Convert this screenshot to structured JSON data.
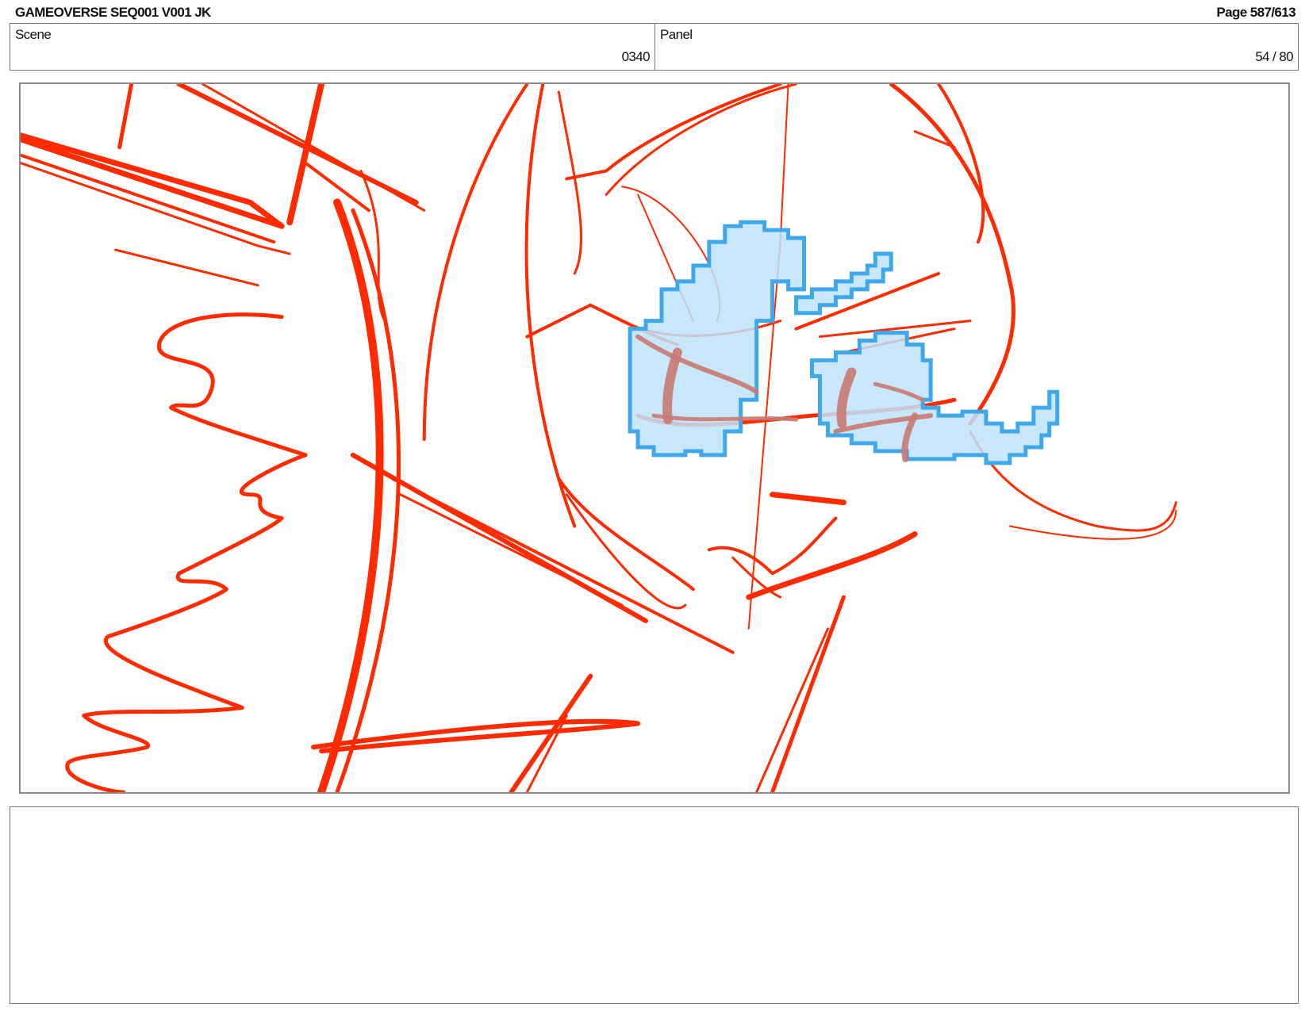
{
  "header": {
    "title": "GAMEOVERSE SEQ001 V001 JK",
    "page": "Page 587/613"
  },
  "info": {
    "scene_label": "Scene",
    "scene_value": "0340",
    "panel_label": "Panel",
    "panel_value": "54 / 80"
  },
  "panel_image": {
    "description_icon": "storyboard-sketch-icon",
    "colors": {
      "sketch_red": "#ff2a00",
      "shade_blue_fill": "#bfe3fa",
      "shade_blue_stroke": "#3ea8ea",
      "eye_shadow": "#c87a72"
    }
  },
  "notes": {
    "text": ""
  }
}
